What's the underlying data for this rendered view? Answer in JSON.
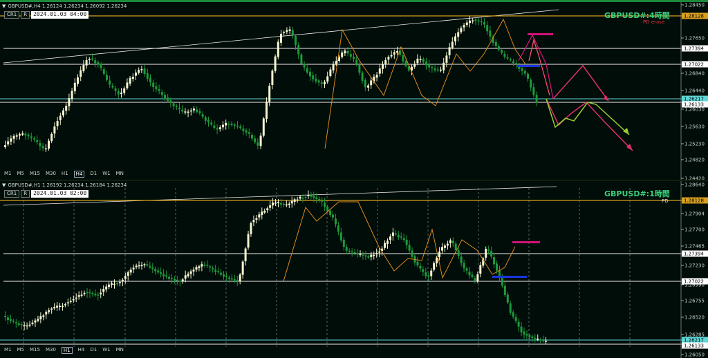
{
  "panes": [
    {
      "id": "top",
      "header": "GBPUSD#,H4  1.26124 1.26234 1.26092 1.26234",
      "cr_label": "CR1",
      "r_label": "R",
      "datetime": "2024.01.03 04:00",
      "title": "GBPUSD#:4時間",
      "note": "PD erase",
      "timeframes": [
        "M1",
        "M5",
        "M15",
        "M30",
        "H1",
        "H4",
        "D1",
        "W1",
        "MN"
      ],
      "active_timeframe": "H4",
      "price_ticks": [
        "1.28450",
        "1.28128",
        "1.27650",
        "1.27394",
        "1.27022",
        "1.26840",
        "1.26440",
        "1.26217",
        "1.26133",
        "1.26030",
        "1.25630",
        "1.25230",
        "1.24820",
        "1.24420"
      ],
      "level_labels": [
        {
          "text": "1.28128",
          "kind": "gold"
        },
        {
          "text": "1.27394",
          "kind": "white"
        },
        {
          "text": "1.27022",
          "kind": "white"
        },
        {
          "text": "1.26217",
          "kind": "cyan"
        },
        {
          "text": "1.26133",
          "kind": "white"
        }
      ]
    },
    {
      "id": "bottom",
      "header": "GBPUSD#,H1  1.26192 1.26234 1.26184 1.26234",
      "cr_label": "CR1",
      "r_label": "R",
      "datetime": "2024.01.03 02:00",
      "title": "GBPUSD#:1時間",
      "note": "PD",
      "timeframes": [
        "M1",
        "M5",
        "M15",
        "M30",
        "H1",
        "H4",
        "D1",
        "W1",
        "MN"
      ],
      "active_timeframe": "H1",
      "price_ticks": [
        "1.28640",
        "1.28128",
        "1.27904",
        "1.27700",
        "1.27465",
        "1.27394",
        "1.27230",
        "1.27022",
        "1.26990",
        "1.26755",
        "1.26520",
        "1.26285",
        "1.26217",
        "1.26133",
        "1.26050"
      ],
      "level_labels": [
        {
          "text": "1.28128",
          "kind": "gold"
        },
        {
          "text": "1.27394",
          "kind": "white"
        },
        {
          "text": "1.27022",
          "kind": "white"
        },
        {
          "text": "1.26217",
          "kind": "cyan"
        },
        {
          "text": "1.26133",
          "kind": "white"
        }
      ]
    }
  ],
  "colors": {
    "background": "#000d09",
    "bull_candle": "#f5f5d0",
    "bear_candle": "#1e9a3a",
    "gold_line": "#d9a020",
    "cyan_line": "#5fd7d7",
    "zigzag": "#e08a1a",
    "pink": "#d2127a",
    "blue": "#1a35e0",
    "title_green": "#3bd17c",
    "note_red": "#e0323a"
  }
}
